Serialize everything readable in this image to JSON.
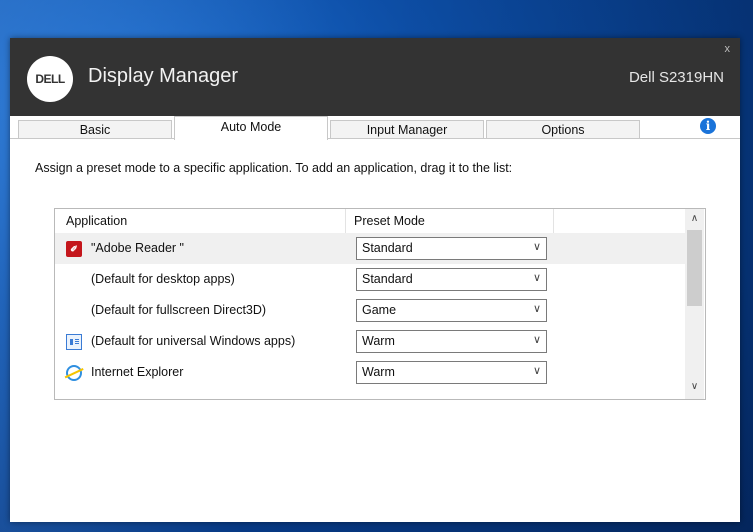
{
  "window": {
    "logo_text": "DELL",
    "title": "Display Manager",
    "monitor": "Dell S2319HN",
    "close_glyph": "x"
  },
  "tabs": [
    {
      "label": "Basic",
      "active": false
    },
    {
      "label": "Auto Mode",
      "active": true
    },
    {
      "label": "Input Manager",
      "active": false
    },
    {
      "label": "Options",
      "active": false
    }
  ],
  "info_glyph": "i",
  "instruction": "Assign a preset mode to a specific application.  To add an application, drag it to the list:",
  "grid": {
    "col_application": "Application",
    "col_preset": "Preset Mode",
    "rows": [
      {
        "icon": "adobe-pdf-icon",
        "label": "\"Adobe Reader \"",
        "preset": "Standard"
      },
      {
        "icon": "",
        "label": "(Default for desktop apps)",
        "preset": "Standard"
      },
      {
        "icon": "",
        "label": "(Default for fullscreen Direct3D)",
        "preset": "Game"
      },
      {
        "icon": "windows-store-icon",
        "label": "(Default for universal Windows apps)",
        "preset": "Warm"
      },
      {
        "icon": "internet-explorer-icon",
        "label": "Internet Explorer",
        "preset": "Warm"
      }
    ],
    "dropdown_glyph": "∨",
    "scroll_up_glyph": "∧",
    "scroll_down_glyph": "∨"
  },
  "colors": {
    "titlebar": "#333333",
    "desktop": "#0d4fa8",
    "info": "#1a73d9",
    "adobe": "#c4161c"
  }
}
